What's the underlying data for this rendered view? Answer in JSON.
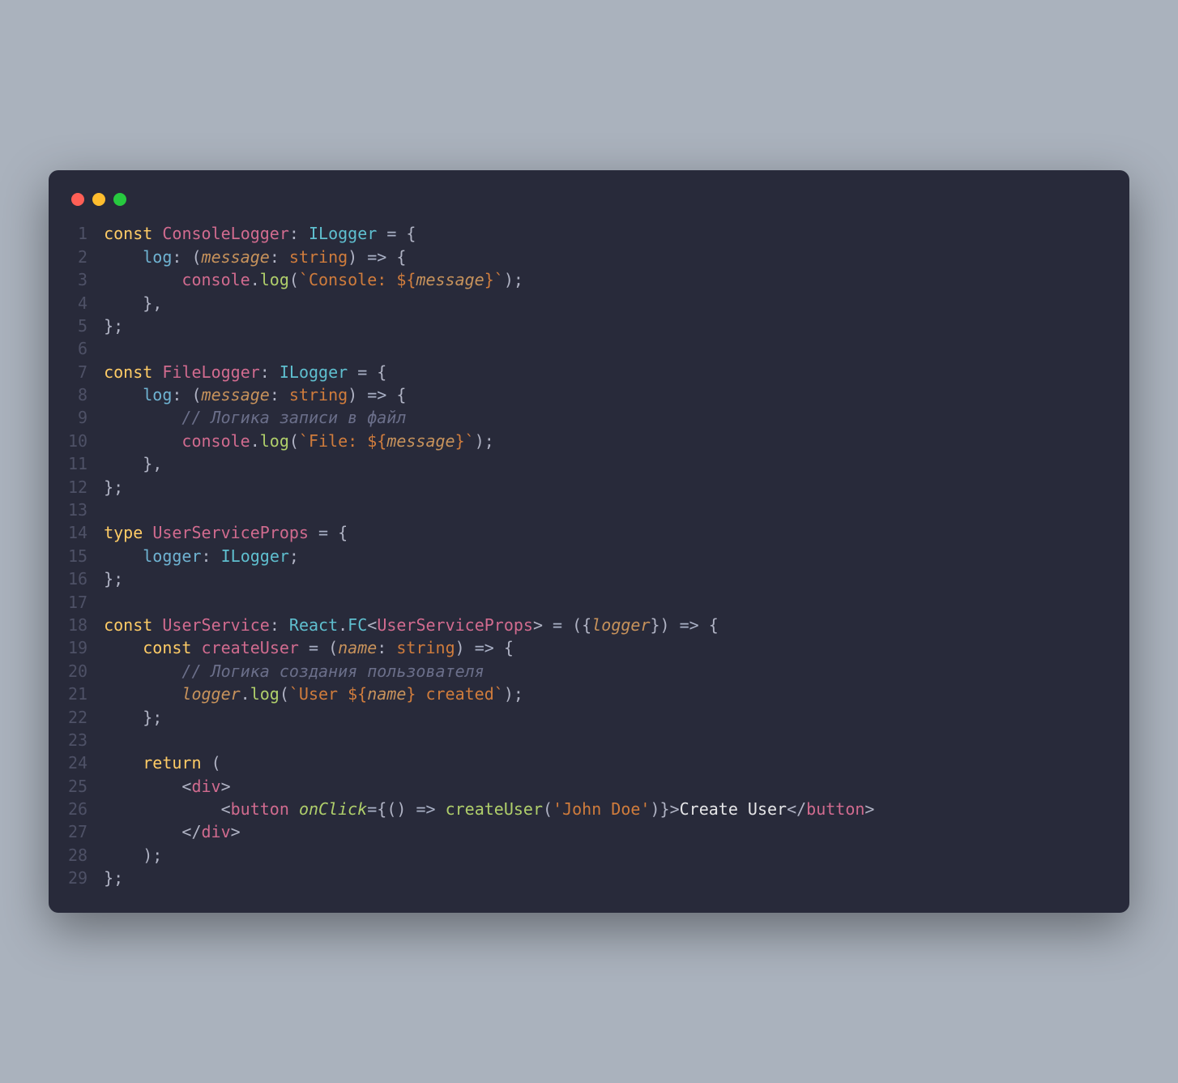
{
  "window": {
    "dots": [
      "red",
      "yellow",
      "green"
    ]
  },
  "code": {
    "line_count": 29,
    "lines": [
      [
        [
          "kw",
          "const"
        ],
        [
          "",
          ""
        ],
        [
          "",
          "  "
        ],
        [
          "var",
          "ConsoleLogger"
        ],
        [
          "punc",
          ": "
        ],
        [
          "typ",
          "ILogger"
        ],
        [
          "",
          ""
        ],
        [
          "op",
          " = "
        ],
        [
          "punc",
          "{"
        ]
      ],
      [
        [
          "",
          "    "
        ],
        [
          "prop",
          "log"
        ],
        [
          "punc",
          ": "
        ],
        [
          "punc",
          "("
        ],
        [
          "param",
          "message"
        ],
        [
          "punc",
          ": "
        ],
        [
          "str",
          "string"
        ],
        [
          "punc",
          ")"
        ],
        [
          "op",
          " => "
        ],
        [
          "punc",
          "{"
        ]
      ],
      [
        [
          "",
          "        "
        ],
        [
          "var",
          "console"
        ],
        [
          "punc",
          "."
        ],
        [
          "fn",
          "log"
        ],
        [
          "punc",
          "("
        ],
        [
          "str",
          "`Console: ${"
        ],
        [
          "param",
          "message"
        ],
        [
          "str",
          "}`"
        ],
        [
          "punc",
          ");"
        ]
      ],
      [
        [
          "",
          "    "
        ],
        [
          "punc",
          "},"
        ]
      ],
      [
        [
          "punc",
          "};"
        ]
      ],
      [
        [
          "",
          ""
        ]
      ],
      [
        [
          "kw",
          "const"
        ],
        [
          "",
          "  "
        ],
        [
          "var",
          "FileLogger"
        ],
        [
          "punc",
          ": "
        ],
        [
          "typ",
          "ILogger"
        ],
        [
          "op",
          " = "
        ],
        [
          "punc",
          "{"
        ]
      ],
      [
        [
          "",
          "    "
        ],
        [
          "prop",
          "log"
        ],
        [
          "punc",
          ": "
        ],
        [
          "punc",
          "("
        ],
        [
          "param",
          "message"
        ],
        [
          "punc",
          ": "
        ],
        [
          "str",
          "string"
        ],
        [
          "punc",
          ")"
        ],
        [
          "op",
          " => "
        ],
        [
          "punc",
          "{"
        ]
      ],
      [
        [
          "",
          "        "
        ],
        [
          "com",
          "// Логика записи в файл"
        ]
      ],
      [
        [
          "",
          "        "
        ],
        [
          "var",
          "console"
        ],
        [
          "punc",
          "."
        ],
        [
          "fn",
          "log"
        ],
        [
          "punc",
          "("
        ],
        [
          "str",
          "`File: ${"
        ],
        [
          "param",
          "message"
        ],
        [
          "str",
          "}`"
        ],
        [
          "punc",
          ");"
        ]
      ],
      [
        [
          "",
          "    "
        ],
        [
          "punc",
          "},"
        ]
      ],
      [
        [
          "punc",
          "};"
        ]
      ],
      [
        [
          "",
          ""
        ]
      ],
      [
        [
          "kw",
          "type"
        ],
        [
          "",
          "  "
        ],
        [
          "var",
          "UserServiceProps"
        ],
        [
          "op",
          " = "
        ],
        [
          "punc",
          "{"
        ]
      ],
      [
        [
          "",
          "    "
        ],
        [
          "prop",
          "logger"
        ],
        [
          "punc",
          ": "
        ],
        [
          "typ",
          "ILogger"
        ],
        [
          "punc",
          ";"
        ]
      ],
      [
        [
          "punc",
          "};"
        ]
      ],
      [
        [
          "",
          ""
        ]
      ],
      [
        [
          "kw",
          "const"
        ],
        [
          "",
          "  "
        ],
        [
          "var",
          "UserService"
        ],
        [
          "punc",
          ": "
        ],
        [
          "typ",
          "React"
        ],
        [
          "punc",
          "."
        ],
        [
          "typ",
          "FC"
        ],
        [
          "punc",
          "<"
        ],
        [
          "var",
          "UserServiceProps"
        ],
        [
          "punc",
          ">"
        ],
        [
          "op",
          " = "
        ],
        [
          "punc",
          "({"
        ],
        [
          "param",
          "logger"
        ],
        [
          "punc",
          "})"
        ],
        [
          "op",
          " => "
        ],
        [
          "punc",
          "{"
        ]
      ],
      [
        [
          "",
          "    "
        ],
        [
          "kw",
          "const"
        ],
        [
          "",
          "  "
        ],
        [
          "var",
          "createUser"
        ],
        [
          "op",
          " = "
        ],
        [
          "punc",
          "("
        ],
        [
          "param",
          "name"
        ],
        [
          "punc",
          ": "
        ],
        [
          "str",
          "string"
        ],
        [
          "punc",
          ")"
        ],
        [
          "op",
          " => "
        ],
        [
          "punc",
          "{"
        ]
      ],
      [
        [
          "",
          "        "
        ],
        [
          "com",
          "// Логика создания пользователя"
        ]
      ],
      [
        [
          "",
          "        "
        ],
        [
          "param",
          "logger"
        ],
        [
          "punc",
          "."
        ],
        [
          "fn",
          "log"
        ],
        [
          "punc",
          "("
        ],
        [
          "str",
          "`User ${"
        ],
        [
          "param",
          "name"
        ],
        [
          "str",
          "} created`"
        ],
        [
          "punc",
          ");"
        ]
      ],
      [
        [
          "",
          "    "
        ],
        [
          "punc",
          "};"
        ]
      ],
      [
        [
          "",
          ""
        ]
      ],
      [
        [
          "",
          "    "
        ],
        [
          "kw",
          "return"
        ],
        [
          "",
          "  "
        ],
        [
          "punc",
          "("
        ]
      ],
      [
        [
          "",
          "        "
        ],
        [
          "punc",
          "<"
        ],
        [
          "var",
          "div"
        ],
        [
          "punc",
          ">"
        ]
      ],
      [
        [
          "",
          "            "
        ],
        [
          "punc",
          "<"
        ],
        [
          "var",
          "button"
        ],
        [
          "",
          "  "
        ],
        [
          "attr",
          "onClick"
        ],
        [
          "op",
          "="
        ],
        [
          "punc",
          "{"
        ],
        [
          "punc",
          "()"
        ],
        [
          "op",
          " => "
        ],
        [
          "fn",
          "createUser"
        ],
        [
          "punc",
          "("
        ],
        [
          "str",
          "'John Doe'"
        ],
        [
          "punc",
          ")"
        ],
        [
          "punc",
          "}"
        ],
        [
          "punc",
          ">"
        ],
        [
          "",
          "Create User"
        ],
        [
          "punc",
          "</"
        ],
        [
          "var",
          "button"
        ],
        [
          "punc",
          ">"
        ]
      ],
      [
        [
          "",
          "        "
        ],
        [
          "punc",
          "</"
        ],
        [
          "var",
          "div"
        ],
        [
          "punc",
          ">"
        ]
      ],
      [
        [
          "",
          "    "
        ],
        [
          "punc",
          ");"
        ]
      ],
      [
        [
          "punc",
          "};"
        ]
      ]
    ]
  }
}
